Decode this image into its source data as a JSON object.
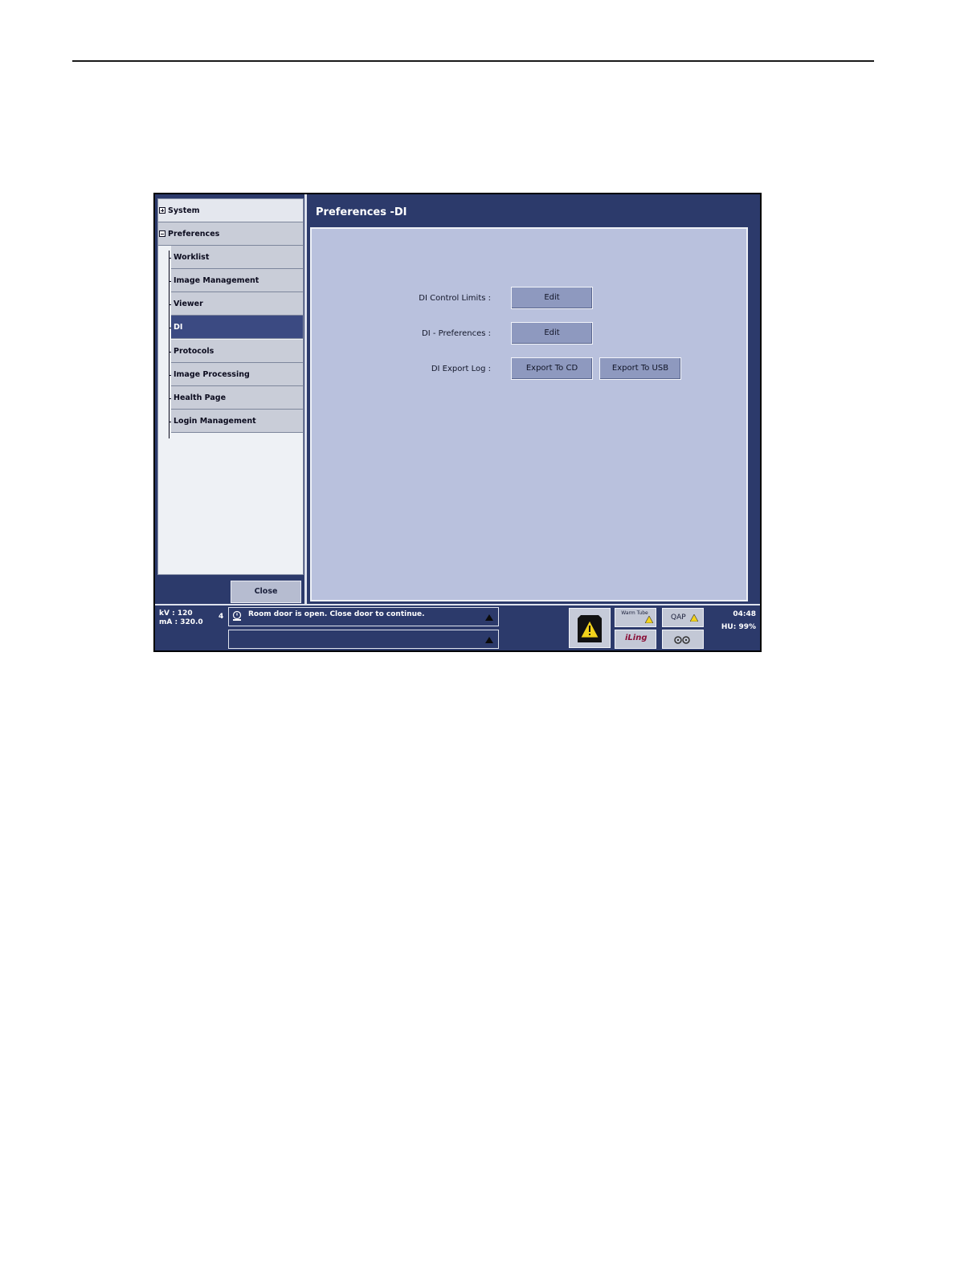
{
  "nav": {
    "items": [
      {
        "label": "System",
        "level": 0,
        "expanded": false
      },
      {
        "label": "Preferences",
        "level": 0,
        "expanded": true
      },
      {
        "label": "Worklist",
        "level": 1
      },
      {
        "label": "Image Management",
        "level": 1
      },
      {
        "label": "Viewer",
        "level": 1
      },
      {
        "label": "DI",
        "level": 1,
        "selected": true
      },
      {
        "label": "Protocols",
        "level": 1
      },
      {
        "label": "Image Processing",
        "level": 1
      },
      {
        "label": "Health Page",
        "level": 1
      },
      {
        "label": "Login Management",
        "level": 1
      }
    ],
    "close_label": "Close"
  },
  "panel": {
    "title": "Preferences -DI",
    "rows": [
      {
        "label": "DI Control Limits :",
        "buttons": [
          "Edit"
        ]
      },
      {
        "label": "DI - Preferences :",
        "buttons": [
          "Edit"
        ]
      },
      {
        "label": "DI Export Log :",
        "buttons": [
          "Export To CD",
          "Export To USB"
        ]
      }
    ]
  },
  "status": {
    "kv": "kV : 120",
    "ma": "mA : 320.0",
    "count": "4",
    "message1": "Room door is open. Close door to continue.",
    "message2": "",
    "warm_tube": "Warm Tube",
    "qap": "QAP",
    "iling": "iLing",
    "time": "04:48",
    "hu": "HU:  99%"
  },
  "colors": {
    "screen_bg": "#2c3a6b",
    "panel_bg": "#b9c1dd",
    "selected_item": "#3b4a82",
    "warning_yellow": "#f2d21b"
  }
}
